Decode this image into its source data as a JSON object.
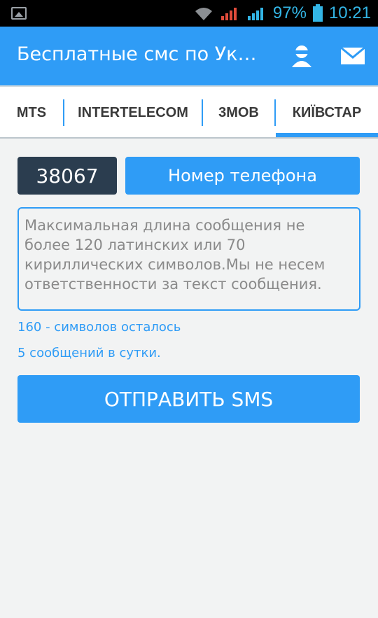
{
  "status_bar": {
    "battery": "97%",
    "time": "10:21",
    "icons": [
      "gallery-icon",
      "wifi-icon",
      "signal-icon",
      "signal-icon",
      "battery-icon"
    ]
  },
  "app_bar": {
    "title": "Бесплатные смс по Укр…",
    "actions": [
      "account-icon",
      "mail-icon"
    ]
  },
  "tabs": [
    {
      "label": "MTS"
    },
    {
      "label": "INTERTELECOM"
    },
    {
      "label": "3MOB"
    },
    {
      "label": "КИЇВСТАР",
      "selected": true
    }
  ],
  "form": {
    "prefix": "38067",
    "phone_placeholder": "Номер телефона",
    "message_placeholder": "Максимальная длина сообщения не более 120 латинских или 70 кириллических символов.Мы не несем ответственности за текст сообщения.",
    "counter": "160 - символов осталось",
    "limit": "5 сообщений в сутки.",
    "send_label": "ОТПРАВИТЬ SMS"
  },
  "colors": {
    "accent": "#2f9cf6",
    "prefix_bg": "#2b3d4f",
    "background": "#f2f3f3"
  }
}
